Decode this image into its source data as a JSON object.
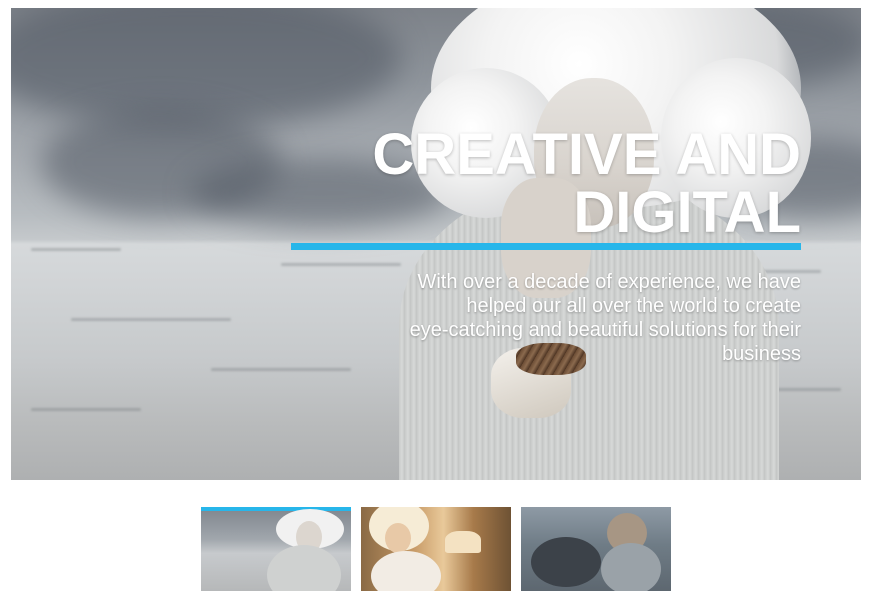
{
  "slide": {
    "headline_line1": "CREATIVE AND",
    "headline_line2": "DIGITAL",
    "tagline_line1": "With over a decade of experience, we have",
    "tagline_line2": "helped our all over the world to create",
    "tagline_line3": "eye-catching and beautiful solutions for their",
    "tagline_line4": "business"
  },
  "thumbnails": [
    {
      "name": "slide-1",
      "active": true
    },
    {
      "name": "slide-2",
      "active": false
    },
    {
      "name": "slide-3",
      "active": false
    }
  ],
  "colors": {
    "accent": "#27b6ea",
    "text": "#ffffff"
  }
}
